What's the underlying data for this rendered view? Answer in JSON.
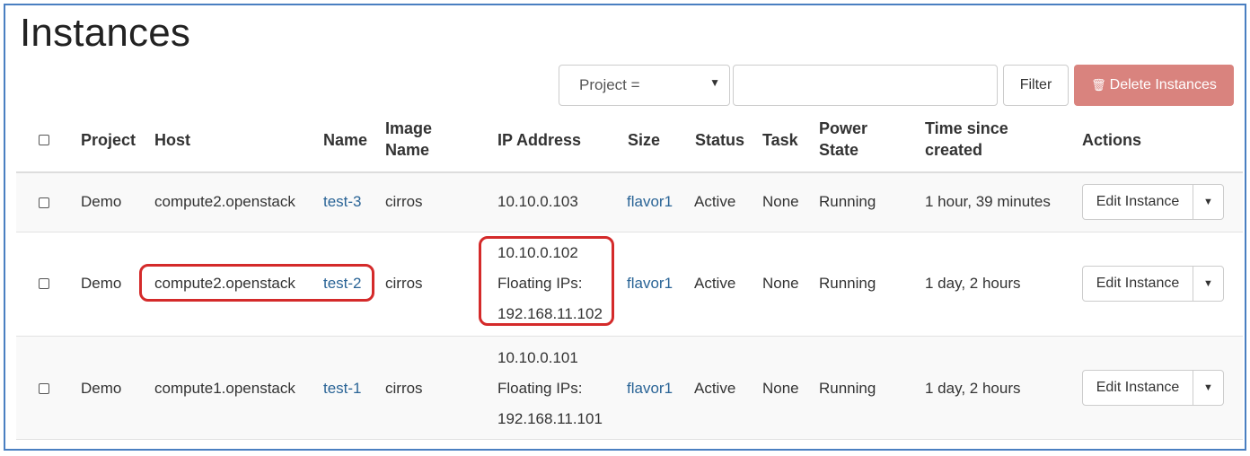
{
  "page": {
    "title": "Instances"
  },
  "toolbar": {
    "filter_field": "Project =",
    "filter_value": "",
    "filter_label": "Filter",
    "delete_label": "Delete Instances",
    "colors": {
      "delete": "#d9837e",
      "link": "#2a6496",
      "highlight": "#d42a2a"
    }
  },
  "table": {
    "headers": {
      "project": "Project",
      "host": "Host",
      "name": "Name",
      "image_1": "Image",
      "image_2": "Name",
      "ip": "IP Address",
      "size": "Size",
      "status": "Status",
      "task": "Task",
      "power_1": "Power",
      "power_2": "State",
      "time_1": "Time since",
      "time_2": "created",
      "actions": "Actions"
    },
    "rows": [
      {
        "project": "Demo",
        "host": "compute2.openstack",
        "name": "test-3",
        "image": "cirros",
        "ip": [
          "10.10.0.103"
        ],
        "size": "flavor1",
        "status": "Active",
        "task": "None",
        "power": "Running",
        "age": "1 hour, 39 minutes",
        "action": "Edit Instance"
      },
      {
        "project": "Demo",
        "host": "compute2.openstack",
        "name": "test-2",
        "image": "cirros",
        "ip": [
          "10.10.0.102",
          "Floating IPs:",
          "192.168.11.102"
        ],
        "size": "flavor1",
        "status": "Active",
        "task": "None",
        "power": "Running",
        "age": "1 day, 2 hours",
        "action": "Edit Instance"
      },
      {
        "project": "Demo",
        "host": "compute1.openstack",
        "name": "test-1",
        "image": "cirros",
        "ip": [
          "10.10.0.101",
          "Floating IPs:",
          "192.168.11.101"
        ],
        "size": "flavor1",
        "status": "Active",
        "task": "None",
        "power": "Running",
        "age": "1 day, 2 hours",
        "action": "Edit Instance"
      }
    ]
  }
}
